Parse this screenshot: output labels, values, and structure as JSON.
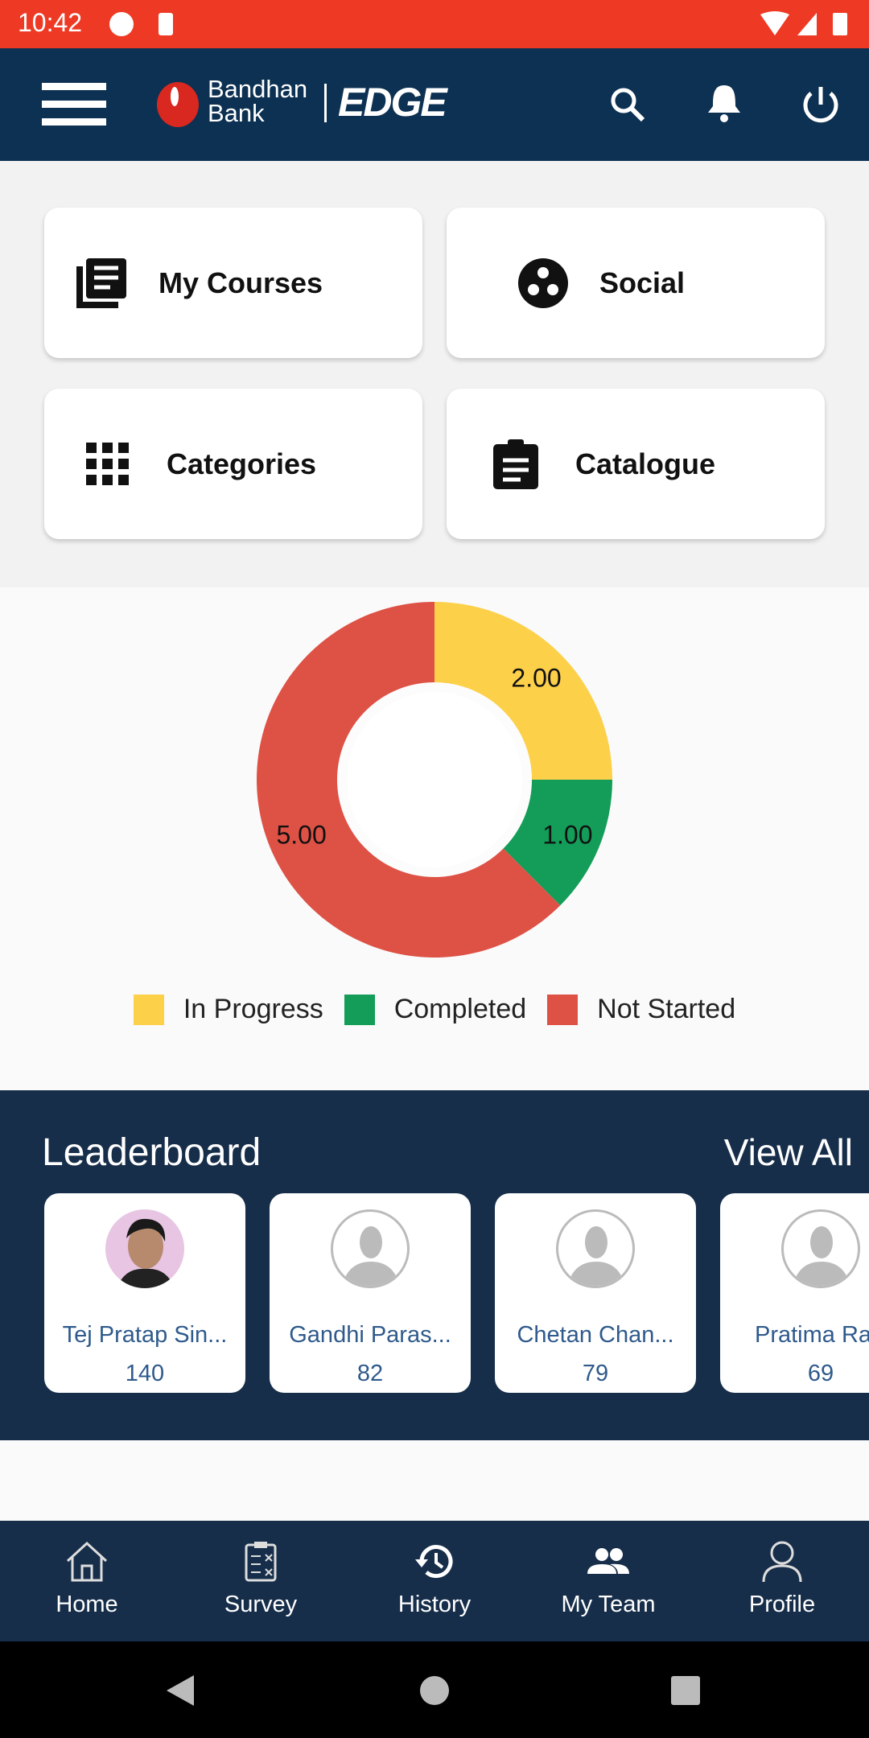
{
  "status_bar": {
    "time": "10:42"
  },
  "header": {
    "brand_line1": "Bandhan",
    "brand_line2": "Bank",
    "product": "EDGE"
  },
  "tiles": [
    {
      "label": "My Courses",
      "icon": "library-books-icon"
    },
    {
      "label": "Social",
      "icon": "social-icon"
    },
    {
      "label": "Categories",
      "icon": "apps-grid-icon"
    },
    {
      "label": "Catalogue",
      "icon": "clipboard-icon"
    }
  ],
  "chart_data": {
    "type": "pie",
    "donut": true,
    "categories": [
      "In Progress",
      "Completed",
      "Not Started"
    ],
    "values": [
      2,
      1,
      5
    ],
    "labels": [
      "2.00",
      "1.00",
      "5.00"
    ],
    "colors": [
      "#fdd04a",
      "#139d58",
      "#de5145"
    ],
    "legend": "bottom"
  },
  "leaderboard": {
    "title": "Leaderboard",
    "view_all": "View All",
    "entries": [
      {
        "name": "Tej Pratap Sin...",
        "score": "140"
      },
      {
        "name": "Gandhi Paras...",
        "score": "82"
      },
      {
        "name": "Chetan Chan...",
        "score": "79"
      },
      {
        "name": "Pratima Ra",
        "score": "69"
      }
    ]
  },
  "bottom_nav": [
    {
      "label": "Home"
    },
    {
      "label": "Survey"
    },
    {
      "label": "History"
    },
    {
      "label": "My Team"
    },
    {
      "label": "Profile"
    }
  ]
}
